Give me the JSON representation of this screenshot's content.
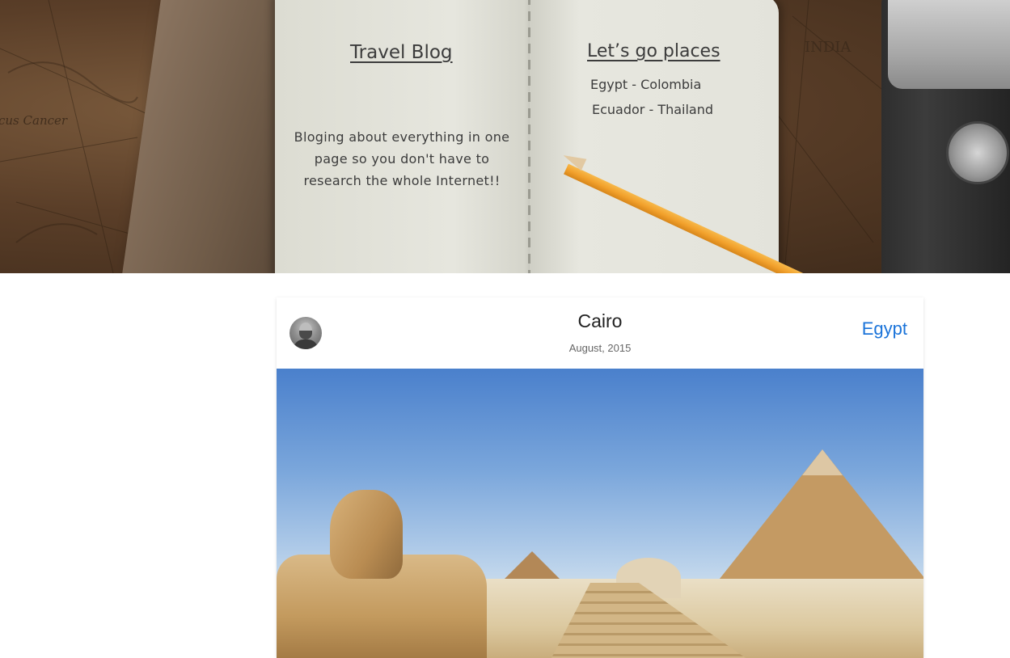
{
  "hero": {
    "notebook": {
      "title": "Travel Blog",
      "tagline": "Bloging about everything in one page so you don't have to research the whole Internet!!",
      "places_title": "Let’s go places",
      "places_line1": "Egypt - Colombia",
      "places_line2": "Ecuador - Thailand"
    },
    "map_labels": {
      "india": "INDIA",
      "tropic": "Tropic of Cancer"
    }
  },
  "post": {
    "title": "Cairo",
    "date": "August, 2015",
    "country": "Egypt",
    "image_alt": "Sphinx and pyramids of Giza"
  },
  "colors": {
    "link": "#1a73d9",
    "card_bg": "#ffffff",
    "page_bg": "#ffffff"
  }
}
